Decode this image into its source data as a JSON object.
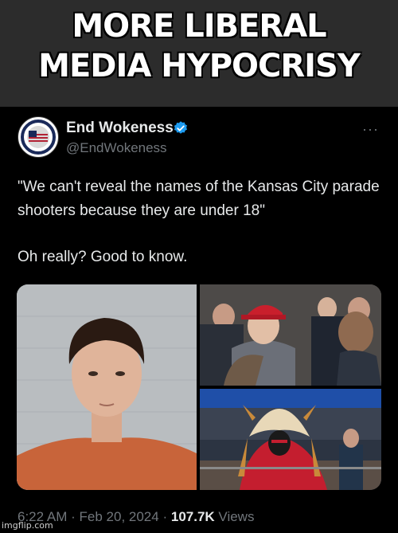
{
  "meme": {
    "caption_line1": "MORE LIBERAL",
    "caption_line2": "MEDIA HYPOCRISY"
  },
  "tweet": {
    "display_name": "End Wokeness",
    "handle": "@EndWokeness",
    "verified": true,
    "more_label": "···",
    "text_line1": "\"We can't reveal the names of the Kansas City parade shooters because they are under 18\"",
    "text_line2": "Oh really? Good to know.",
    "time": "6:22 AM",
    "separator": "·",
    "date": "Feb 20, 2024",
    "views_count": "107.7K",
    "views_label": "Views"
  },
  "colors": {
    "accent_verified": "#1d9bf0",
    "text_primary": "#e7e9ea",
    "text_secondary": "#71767b",
    "caption_bg": "#2c2c2c"
  },
  "watermark": "imgflip.com"
}
